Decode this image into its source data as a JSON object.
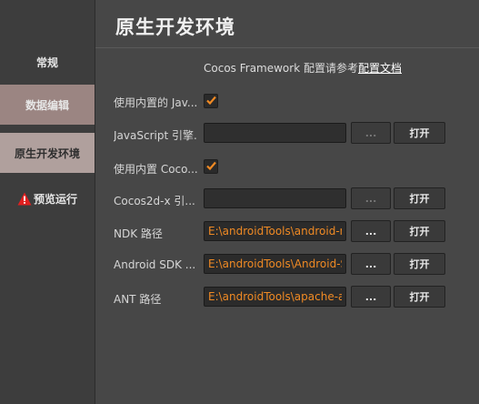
{
  "sidebar": {
    "items": [
      {
        "label": "常规"
      },
      {
        "label": "数据编辑"
      },
      {
        "label": "原生开发环境"
      },
      {
        "label": "预览运行"
      }
    ]
  },
  "main": {
    "title": "原生开发环境",
    "hint_prefix": "Cocos Framework 配置请参考",
    "hint_link": "配置文档",
    "rows": [
      {
        "label": "使用内置的 Jav...",
        "checked": true
      },
      {
        "label": "JavaScript 引擎...",
        "value": "",
        "dots": "...",
        "open": "打开"
      },
      {
        "label": "使用内置 Coco...",
        "checked": true
      },
      {
        "label": "Cocos2d-x 引...",
        "value": "",
        "dots": "...",
        "open": "打开"
      },
      {
        "label": "NDK 路径",
        "value": "E:\\androidTools\\android-ndk",
        "dots": "...",
        "open": "打开"
      },
      {
        "label": "Android SDK ...",
        "value": "E:\\androidTools\\Android-SDK",
        "dots": "...",
        "open": "打开"
      },
      {
        "label": "ANT 路径",
        "value": "E:\\androidTools\\apache-ant",
        "dots": "...",
        "open": "打开"
      }
    ]
  },
  "colors": {
    "accent_path": "#f08a24",
    "check": "#f08a24",
    "warning": "#e02020",
    "active_nav": "#9b8582"
  }
}
